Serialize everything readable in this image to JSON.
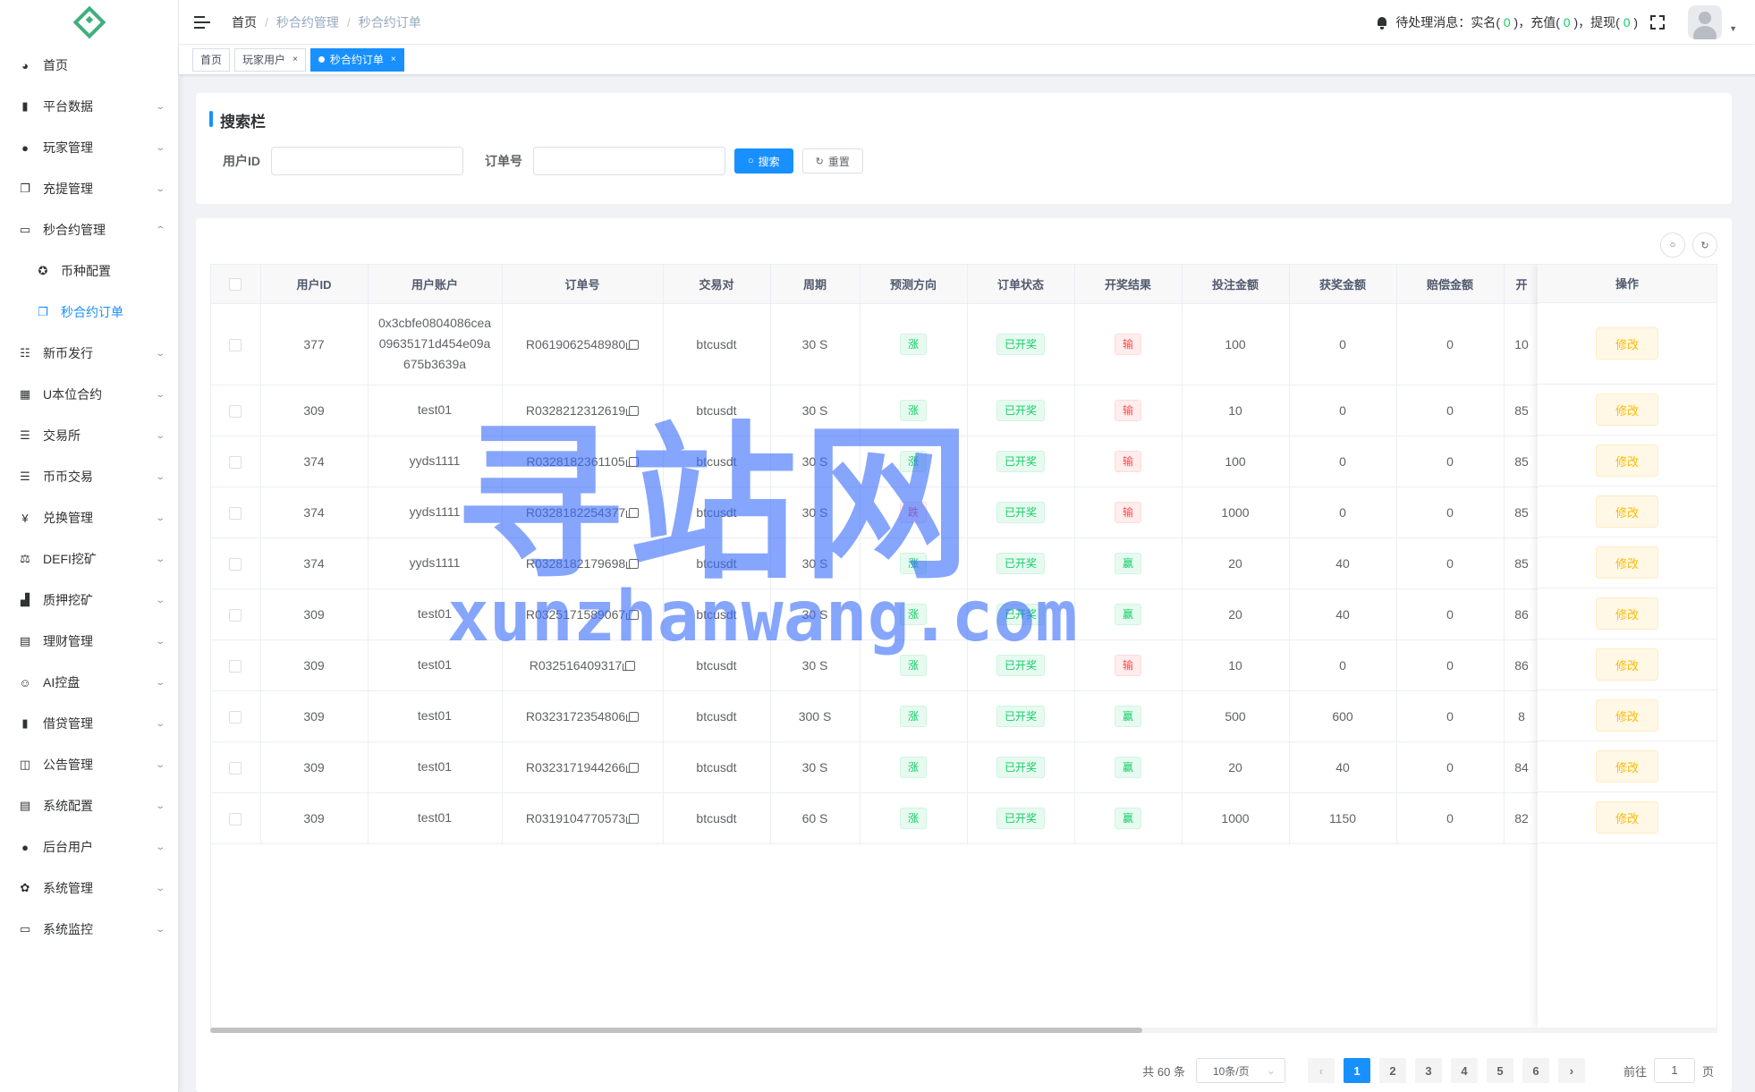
{
  "sidebar": {
    "items": [
      {
        "label": "首页",
        "icon": "dashboard-icon",
        "glyph": "◕",
        "arrow": ""
      },
      {
        "label": "平台数据",
        "icon": "book-icon",
        "glyph": "▮",
        "arrow": "⌄"
      },
      {
        "label": "玩家管理",
        "icon": "user-icon",
        "glyph": "●",
        "arrow": "⌄"
      },
      {
        "label": "充提管理",
        "icon": "copy-icon",
        "glyph": "❐",
        "arrow": "⌄"
      },
      {
        "label": "秒合约管理",
        "icon": "monitor-icon",
        "glyph": "▭",
        "arrow": "⌃"
      },
      {
        "label": "币种配置",
        "icon": "gear-icon",
        "glyph": "✪",
        "arrow": "",
        "sub": true
      },
      {
        "label": "秒合约订单",
        "icon": "copy-icon",
        "glyph": "❐",
        "arrow": "",
        "sub": true,
        "active": true
      },
      {
        "label": "新币发行",
        "icon": "list-icon",
        "glyph": "☷",
        "arrow": "⌄"
      },
      {
        "label": "U本位合约",
        "icon": "table-icon",
        "glyph": "▦",
        "arrow": "⌄"
      },
      {
        "label": "交易所",
        "icon": "tree-icon",
        "glyph": "☰",
        "arrow": "⌄"
      },
      {
        "label": "币币交易",
        "icon": "list-icon",
        "glyph": "☰",
        "arrow": "⌄"
      },
      {
        "label": "兑换管理",
        "icon": "yen-icon",
        "glyph": "¥",
        "arrow": "⌄"
      },
      {
        "label": "DEFI挖矿",
        "icon": "money-bag-icon",
        "glyph": "⚖",
        "arrow": "⌄"
      },
      {
        "label": "质押挖矿",
        "icon": "chart-icon",
        "glyph": "▟",
        "arrow": "⌄"
      },
      {
        "label": "理财管理",
        "icon": "document-icon",
        "glyph": "▤",
        "arrow": "⌄"
      },
      {
        "label": "AI控盘",
        "icon": "robot-icon",
        "glyph": "☺",
        "arrow": "⌄"
      },
      {
        "label": "借贷管理",
        "icon": "book-icon",
        "glyph": "▮",
        "arrow": "⌄"
      },
      {
        "label": "公告管理",
        "icon": "open-book-icon",
        "glyph": "◫",
        "arrow": "⌄"
      },
      {
        "label": "系统配置",
        "icon": "document-icon",
        "glyph": "▤",
        "arrow": "⌄"
      },
      {
        "label": "后台用户",
        "icon": "users-icon",
        "glyph": "●",
        "arrow": "⌄"
      },
      {
        "label": "系统管理",
        "icon": "gear-icon",
        "glyph": "✿",
        "arrow": "⌄"
      },
      {
        "label": "系统监控",
        "icon": "monitor-icon",
        "glyph": "▭",
        "arrow": "⌄"
      }
    ]
  },
  "navbar": {
    "breadcrumb": [
      "首页",
      "秒合约管理",
      "秒合约订单"
    ],
    "pending_label": "待处理消息：",
    "pending": [
      {
        "label": "实名",
        "count": "0"
      },
      {
        "label": "充值",
        "count": "0"
      },
      {
        "label": "提现",
        "count": "0"
      }
    ]
  },
  "tags": [
    {
      "label": "首页",
      "closable": false,
      "active": false
    },
    {
      "label": "玩家用户",
      "closable": true,
      "active": false
    },
    {
      "label": "秒合约订单",
      "closable": true,
      "active": true
    }
  ],
  "search": {
    "title": "搜索栏",
    "user_id_label": "用户ID",
    "order_no_label": "订单号",
    "search_btn": "搜索",
    "reset_btn": "重置"
  },
  "table": {
    "columns": [
      "用户ID",
      "用户账户",
      "订单号",
      "交易对",
      "周期",
      "预测方向",
      "订单状态",
      "开奖结果",
      "投注金额",
      "获奖金额",
      "赔偿金额",
      "开"
    ],
    "action_col": "操作",
    "edit_label": "修改",
    "rows": [
      {
        "uid": "377",
        "acct": "0x3cbfe0804086cea09635171d454e09a675b3639a",
        "order": "R0619062548980",
        "pair": "btcusdt",
        "period": "30 S",
        "dir": "涨",
        "dir_color": "g",
        "status": "已开奖",
        "result": "输",
        "res_color": "r",
        "bet": "100",
        "win": "0",
        "comp": "0",
        "extra": "10"
      },
      {
        "uid": "309",
        "acct": "test01",
        "order": "R0328212312619",
        "pair": "btcusdt",
        "period": "30 S",
        "dir": "涨",
        "dir_color": "g",
        "status": "已开奖",
        "result": "输",
        "res_color": "r",
        "bet": "10",
        "win": "0",
        "comp": "0",
        "extra": "85"
      },
      {
        "uid": "374",
        "acct": "yyds1111",
        "order": "R0328182361105",
        "pair": "btcusdt",
        "period": "30 S",
        "dir": "涨",
        "dir_color": "g",
        "status": "已开奖",
        "result": "输",
        "res_color": "r",
        "bet": "100",
        "win": "0",
        "comp": "0",
        "extra": "85"
      },
      {
        "uid": "374",
        "acct": "yyds1111",
        "order": "R0328182254377",
        "pair": "btcusdt",
        "period": "30 S",
        "dir": "跌",
        "dir_color": "p",
        "status": "已开奖",
        "result": "输",
        "res_color": "r",
        "bet": "1000",
        "win": "0",
        "comp": "0",
        "extra": "85"
      },
      {
        "uid": "374",
        "acct": "yyds1111",
        "order": "R0328182179698",
        "pair": "btcusdt",
        "period": "30 S",
        "dir": "涨",
        "dir_color": "g",
        "status": "已开奖",
        "result": "赢",
        "res_color": "g",
        "bet": "20",
        "win": "40",
        "comp": "0",
        "extra": "85"
      },
      {
        "uid": "309",
        "acct": "test01",
        "order": "R0325171589067",
        "pair": "btcusdt",
        "period": "30 S",
        "dir": "涨",
        "dir_color": "g",
        "status": "已开奖",
        "result": "赢",
        "res_color": "g",
        "bet": "20",
        "win": "40",
        "comp": "0",
        "extra": "86"
      },
      {
        "uid": "309",
        "acct": "test01",
        "order": "R032516409317",
        "pair": "btcusdt",
        "period": "30 S",
        "dir": "涨",
        "dir_color": "g",
        "status": "已开奖",
        "result": "输",
        "res_color": "r",
        "bet": "10",
        "win": "0",
        "comp": "0",
        "extra": "86"
      },
      {
        "uid": "309",
        "acct": "test01",
        "order": "R0323172354806",
        "pair": "btcusdt",
        "period": "300 S",
        "dir": "涨",
        "dir_color": "g",
        "status": "已开奖",
        "result": "赢",
        "res_color": "g",
        "bet": "500",
        "win": "600",
        "comp": "0",
        "extra": "8"
      },
      {
        "uid": "309",
        "acct": "test01",
        "order": "R0323171944266",
        "pair": "btcusdt",
        "period": "30 S",
        "dir": "涨",
        "dir_color": "g",
        "status": "已开奖",
        "result": "赢",
        "res_color": "g",
        "bet": "20",
        "win": "40",
        "comp": "0",
        "extra": "84"
      },
      {
        "uid": "309",
        "acct": "test01",
        "order": "R0319104770573",
        "pair": "btcusdt",
        "period": "60 S",
        "dir": "涨",
        "dir_color": "g",
        "status": "已开奖",
        "result": "赢",
        "res_color": "g",
        "bet": "1000",
        "win": "1150",
        "comp": "0",
        "extra": "82"
      }
    ]
  },
  "pagination": {
    "total": "共 60 条",
    "page_size": "10条/页",
    "pages": [
      "1",
      "2",
      "3",
      "4",
      "5",
      "6"
    ],
    "current": "1",
    "goto_label": "前往",
    "goto_value": "1",
    "goto_suffix": "页"
  },
  "watermark": {
    "cn": "寻站网",
    "en": "xunzhanwang.com"
  },
  "colors": {
    "primary": "#1890ff",
    "success": "#13ce66",
    "danger": "#ff4949",
    "warning": "#ffba00"
  }
}
